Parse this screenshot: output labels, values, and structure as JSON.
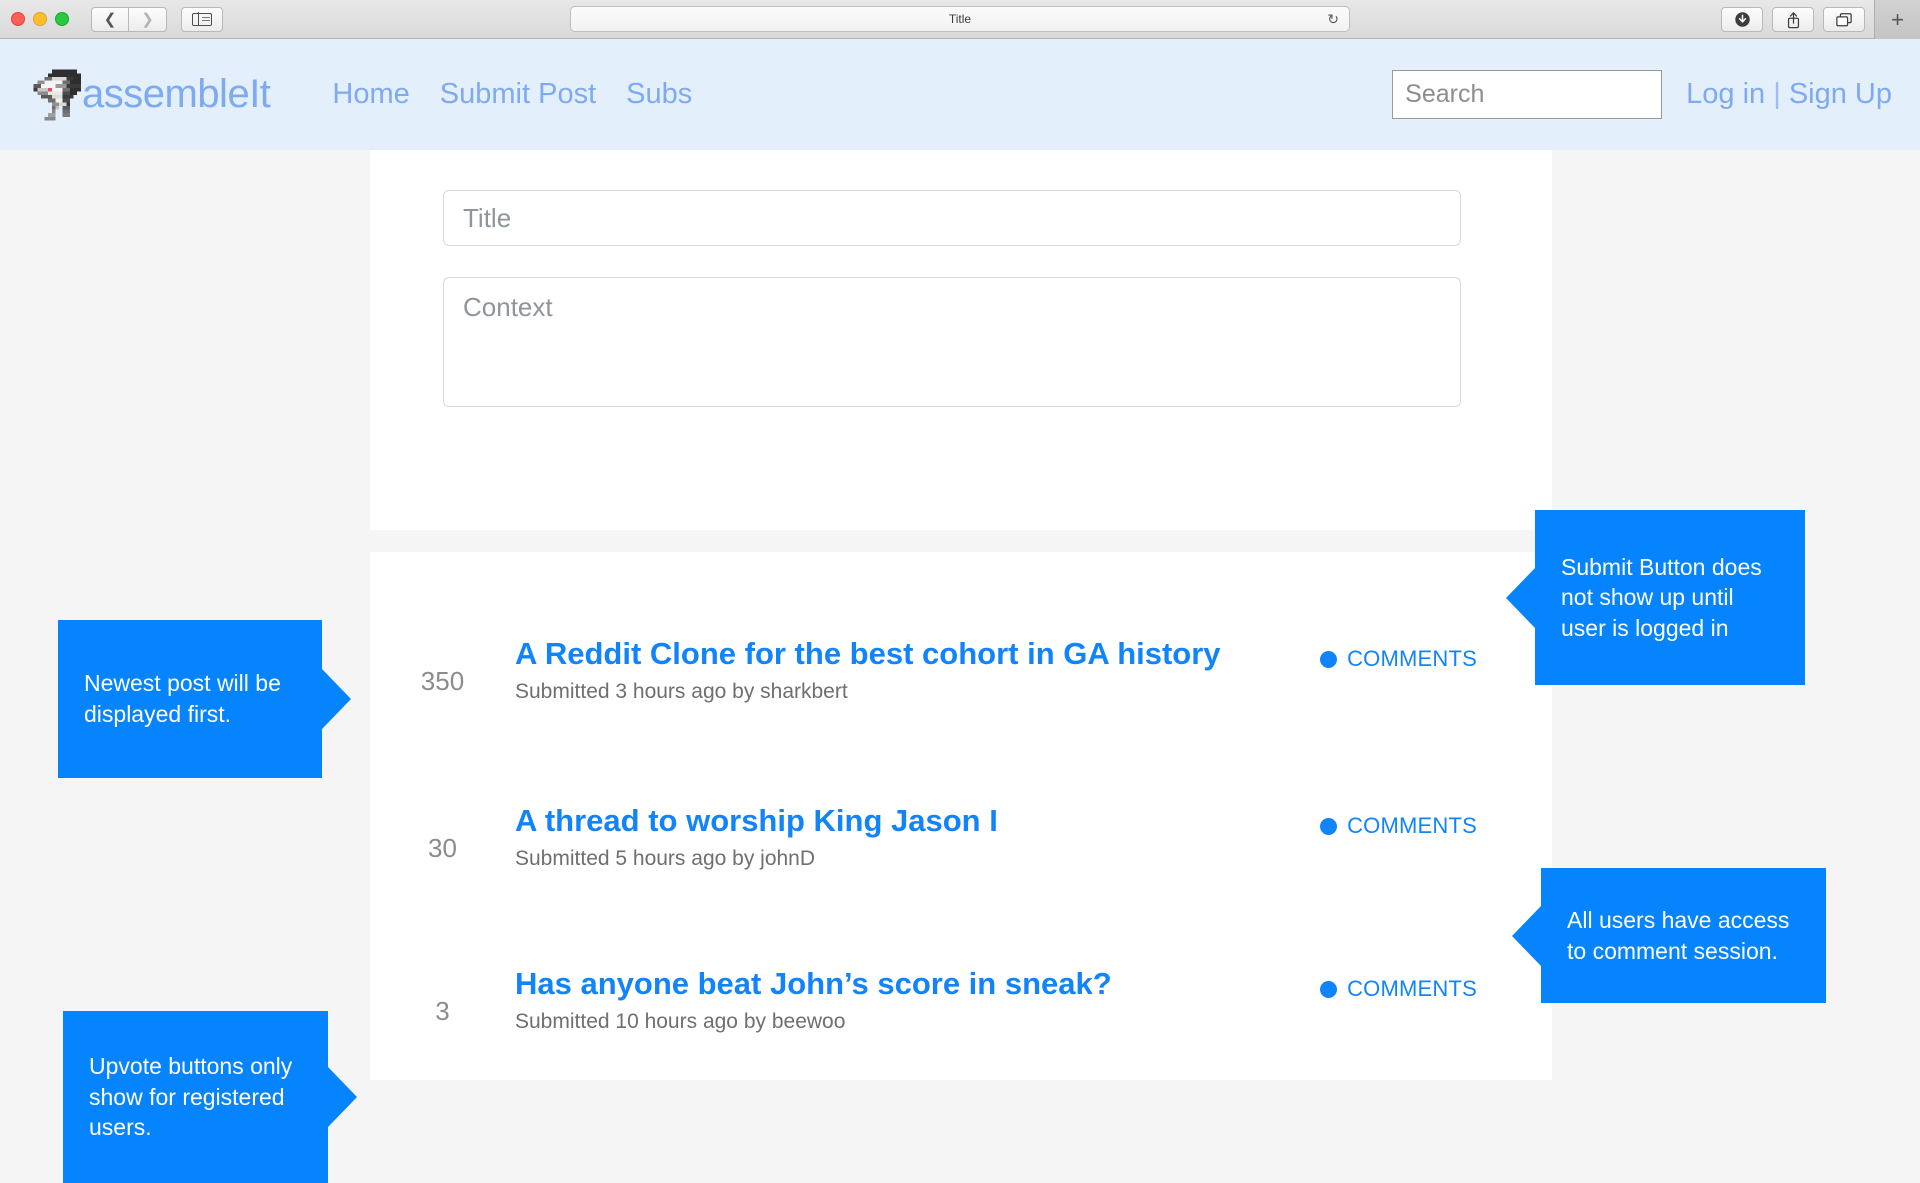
{
  "browser": {
    "title": "Title",
    "back_icon": "chevron-left-icon",
    "forward_icon": "chevron-right-icon",
    "sidebar_icon": "sidebar-toggle-icon",
    "reload_icon": "↻",
    "download_icon": "download-icon",
    "share_icon": "share-icon",
    "tabs_icon": "tab-overview-icon",
    "new_tab_label": "+"
  },
  "header": {
    "brand": "assembleIt",
    "logo_icon": "shark-logo-icon",
    "nav": [
      {
        "label": "Home"
      },
      {
        "label": "Submit Post"
      },
      {
        "label": "Subs"
      }
    ],
    "search": {
      "placeholder": "Search",
      "value": ""
    },
    "auth": {
      "login": "Log in",
      "separator": "|",
      "signup": "Sign Up"
    },
    "bg_color": "#e3f0fc",
    "link_color": "#7fa9f0"
  },
  "submit_form": {
    "title_placeholder": "Title",
    "title_value": "",
    "context_placeholder": "Context",
    "context_value": ""
  },
  "posts": {
    "comments_label": "COMMENTS",
    "items": [
      {
        "score": "350",
        "title": "A Reddit Clone for the best cohort in GA history",
        "meta": "Submitted 3 hours ago by sharkbert"
      },
      {
        "score": "30",
        "title": "A thread to worship King Jason I",
        "meta": "Submitted 5 hours ago by johnD"
      },
      {
        "score": "3",
        "title": "Has anyone beat John’s score in sneak?",
        "meta": "Submitted 10 hours ago by beewoo"
      }
    ]
  },
  "annotations": {
    "color": "#0584fd",
    "items": [
      {
        "id": "newest",
        "text": "Newest post will be displayed first."
      },
      {
        "id": "upvote",
        "text": "Upvote buttons only show for registered users."
      },
      {
        "id": "submit",
        "text": "Submit Button does not show up until user is logged in"
      },
      {
        "id": "comment",
        "text": "All users have access to comment session."
      }
    ]
  },
  "theme": {
    "accent": "#1284fb",
    "page_bg": "#f5f5f5",
    "panel_bg": "#ffffff"
  }
}
